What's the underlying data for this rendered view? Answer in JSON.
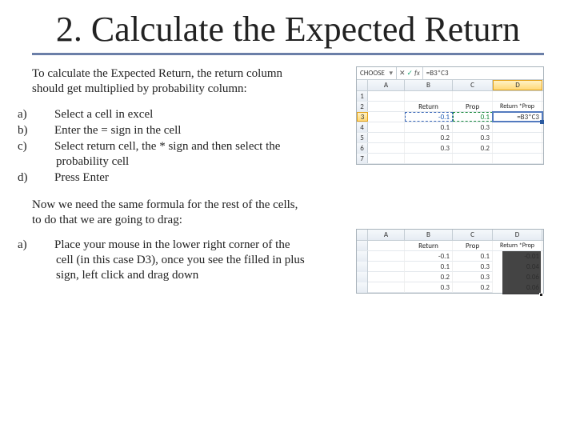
{
  "title": "2. Calculate the Expected Return",
  "intro": "To calculate the Expected Return, the return column should get multiplied by probability column:",
  "steps1": {
    "a": "Select a cell in excel",
    "b": "Enter the = sign in the cell",
    "c": "Select return cell, the * sign and then select the probability cell",
    "d": "Press Enter"
  },
  "mid": "Now we need the same formula for the rest of the cells, to do that we are going to drag:",
  "steps2": {
    "a": "Place your mouse in the lower right corner of the cell (in this case D3), once you see the filled in plus sign, left click and drag down"
  },
  "excel1": {
    "namebox": "CHOOSE",
    "formula": "=B3*C3",
    "cols": [
      "A",
      "B",
      "C",
      "D"
    ],
    "headerRow": {
      "B": "Return",
      "C": "Prop",
      "D": "Return *Prop"
    },
    "rows": [
      {
        "n": "1"
      },
      {
        "n": "2"
      },
      {
        "n": "3",
        "B": "-0.1",
        "C": "0.1",
        "D": "=B3*C3",
        "active": true
      },
      {
        "n": "4",
        "B": "0.1",
        "C": "0.3"
      },
      {
        "n": "5",
        "B": "0.2",
        "C": "0.3"
      },
      {
        "n": "6",
        "B": "0.3",
        "C": "0.2"
      },
      {
        "n": "7"
      }
    ]
  },
  "excel2": {
    "cols": [
      "A",
      "B",
      "C",
      "D"
    ],
    "headerRow": {
      "B": "Return",
      "C": "Prop",
      "D": "Return *Prop"
    },
    "rows": [
      {
        "B": "-0.1",
        "C": "0.1",
        "D": "-0.01"
      },
      {
        "B": "0.1",
        "C": "0.3",
        "D": "0.04"
      },
      {
        "B": "0.2",
        "C": "0.3",
        "D": "0.06"
      },
      {
        "B": "0.3",
        "C": "0.2",
        "D": "0.06"
      }
    ]
  }
}
